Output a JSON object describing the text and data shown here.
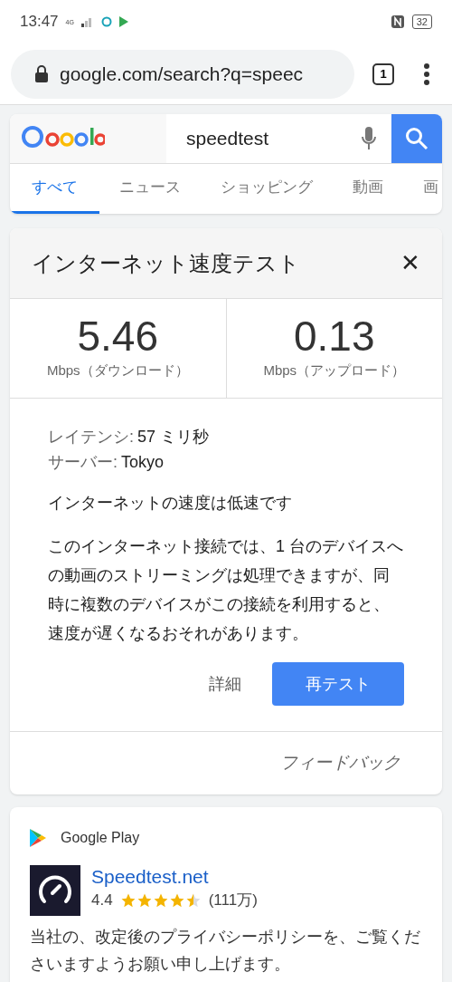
{
  "status_bar": {
    "time": "13:47",
    "network": "4G",
    "battery": "32"
  },
  "browser": {
    "url": "google.com/search?q=speec",
    "tab_count": "1"
  },
  "search": {
    "query": "speedtest"
  },
  "tabs": [
    {
      "label": "すべて",
      "selected": true
    },
    {
      "label": "ニュース",
      "selected": false
    },
    {
      "label": "ショッピング",
      "selected": false
    },
    {
      "label": "動画",
      "selected": false
    },
    {
      "label": "画",
      "selected": false
    }
  ],
  "speed_card": {
    "title": "インターネット速度テスト",
    "close": "✕",
    "results": [
      {
        "value": "5.46",
        "unit": "Mbps（ダウンロード）"
      },
      {
        "value": "0.13",
        "unit": "Mbps（アップロード）"
      }
    ],
    "details": [
      {
        "label": "レイテンシ:",
        "value": "57 ミリ秒"
      },
      {
        "label": "サーバー:",
        "value": "Tokyo"
      }
    ],
    "verdict": "インターネットの速度は低速です",
    "description": "このインターネット接続では、1 台のデバイスへの動画のストリーミングは処理できますが、同時に複数のデバイスがこの接続を利用すると、速度が遅くなるおそれがあります。",
    "details_link": "詳細",
    "retest_button": "再テスト",
    "feedback": "フィードバック"
  },
  "app_card": {
    "source": "Google Play",
    "app_name": "Speedtest.net",
    "rating": "4.4",
    "stars": 4.5,
    "reviews": "(111万)",
    "notice": "当社の、改定後のプライバシーポリシーを、ご覧くださいますようお願い申し上げます。"
  }
}
